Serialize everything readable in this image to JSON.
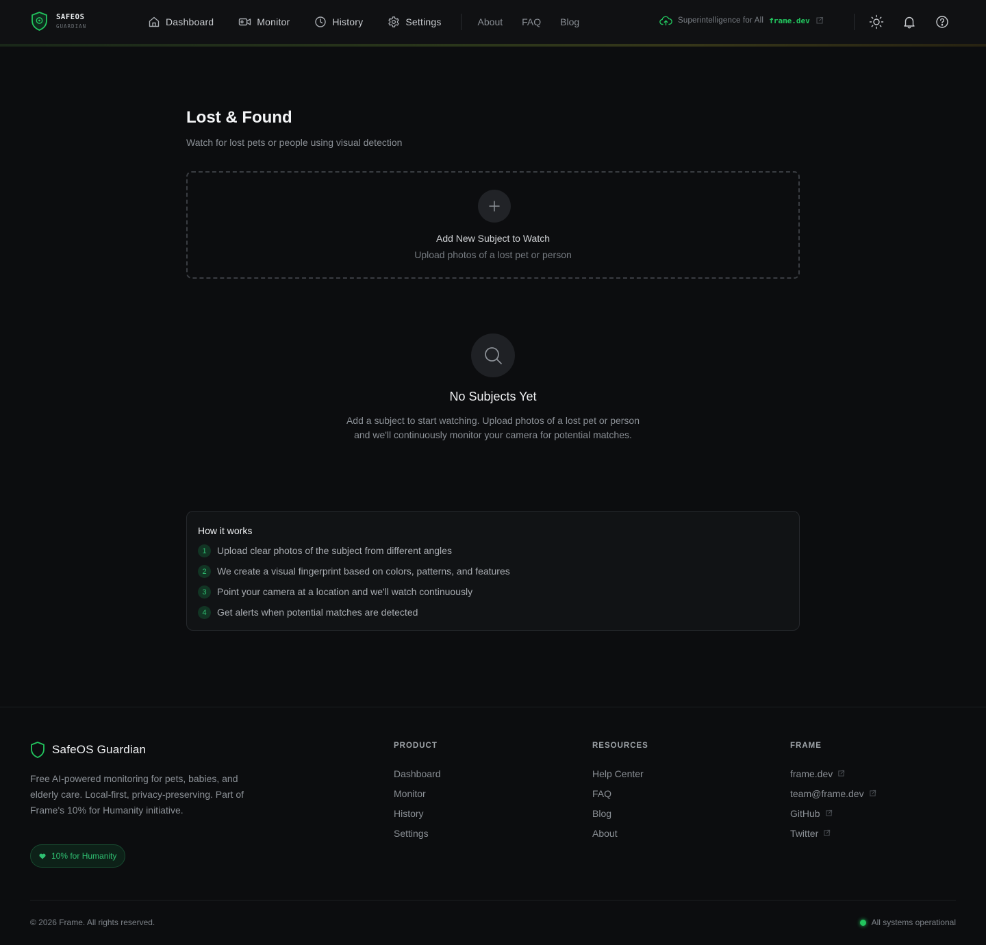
{
  "colors": {
    "background": "#0c0d0f",
    "accent": "#22c55e",
    "header_background": "#101113",
    "card_background": "#111315"
  },
  "brand": {
    "name": "SAFEOS",
    "subtitle": "GUARDIAN",
    "icon": "shield-icon"
  },
  "nav": {
    "items": [
      {
        "label": "Dashboard",
        "icon": "home-icon"
      },
      {
        "label": "Monitor",
        "icon": "video-camera-icon"
      },
      {
        "label": "History",
        "icon": "clock-icon"
      },
      {
        "label": "Settings",
        "icon": "gear-icon"
      }
    ],
    "links": [
      "About",
      "FAQ",
      "Blog"
    ]
  },
  "header": {
    "tagline": "Superintelligence for All",
    "tagline_link": "frame.dev",
    "buttons": [
      "sun-icon",
      "bell-icon",
      "help-circle-icon"
    ]
  },
  "main": {
    "title": "Lost & Found",
    "subtitle": "Watch for lost pets or people using visual detection",
    "add_card": {
      "title": "Add New Subject to Watch",
      "subtitle": "Upload photos of a lost pet or person"
    },
    "empty_state": {
      "title": "No Subjects Yet",
      "description": "Add a subject to start watching. Upload photos of a lost pet or person and we'll continuously monitor your camera for potential matches."
    },
    "how_it_works": {
      "title": "How it works",
      "steps": [
        {
          "num": "1",
          "text": "Upload clear photos of the subject from different angles"
        },
        {
          "num": "2",
          "text": "We create a visual fingerprint based on colors, patterns, and features"
        },
        {
          "num": "3",
          "text": "Point your camera at a location and we'll watch continuously"
        },
        {
          "num": "4",
          "text": "Get alerts when potential matches are detected"
        }
      ]
    }
  },
  "footer": {
    "brand": "SafeOS Guardian",
    "description": "Free AI-powered monitoring for pets, babies, and elderly care. Local-first, privacy-preserving. Part of Frame's 10% for Humanity initiative.",
    "badge": "10% for Humanity",
    "columns": [
      {
        "title": "PRODUCT",
        "links": [
          {
            "label": "Dashboard",
            "external": false
          },
          {
            "label": "Monitor",
            "external": false
          },
          {
            "label": "History",
            "external": false
          },
          {
            "label": "Settings",
            "external": false
          }
        ]
      },
      {
        "title": "RESOURCES",
        "links": [
          {
            "label": "Help Center",
            "external": false
          },
          {
            "label": "FAQ",
            "external": false
          },
          {
            "label": "Blog",
            "external": false
          },
          {
            "label": "About",
            "external": false
          }
        ]
      },
      {
        "title": "FRAME",
        "links": [
          {
            "label": "frame.dev",
            "external": true
          },
          {
            "label": "team@frame.dev",
            "external": true
          },
          {
            "label": "GitHub",
            "external": true
          },
          {
            "label": "Twitter",
            "external": true
          }
        ]
      }
    ],
    "copyright": "© 2026 Frame. All rights reserved.",
    "status": "All systems operational"
  }
}
